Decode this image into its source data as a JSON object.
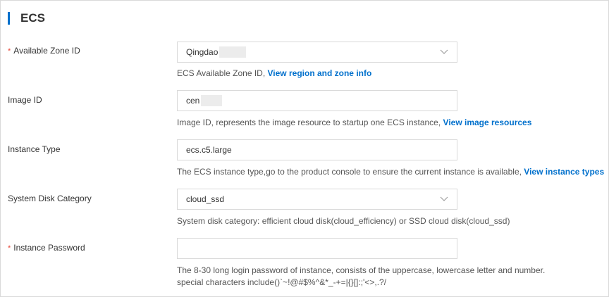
{
  "section": {
    "title": "ECS"
  },
  "fields": [
    {
      "label": "Available Zone ID",
      "required": true,
      "value": "Qingdao",
      "help": "ECS Available Zone ID, ",
      "link": "View region and zone info"
    },
    {
      "label": "Image ID",
      "required": false,
      "value": "cen",
      "help": "Image ID, represents the image resource to startup one ECS instance, ",
      "link": "View image resources"
    },
    {
      "label": "Instance Type",
      "required": false,
      "value": "ecs.c5.large",
      "help": "The ECS instance type,go to the product console to ensure the current instance is available, ",
      "link": "View instance types"
    },
    {
      "label": "System Disk Category",
      "required": false,
      "value": "cloud_ssd",
      "help": "System disk category: efficient cloud disk(cloud_efficiency) or SSD cloud disk(cloud_ssd)"
    },
    {
      "label": "Instance Password",
      "required": true,
      "value": "",
      "help_line1": "The 8-30 long login password of instance, consists of the uppercase, lowercase letter and number.",
      "help_line2": "special characters include()`~!@#$%^&*_-+=|{}[]:;'<>,.?/"
    }
  ],
  "required_marker": "*",
  "colors": {
    "accent": "#0070cc",
    "required": "#e84738",
    "border": "#d9d9d9"
  },
  "icons": {
    "select_arrow": "chevron-down-icon"
  }
}
